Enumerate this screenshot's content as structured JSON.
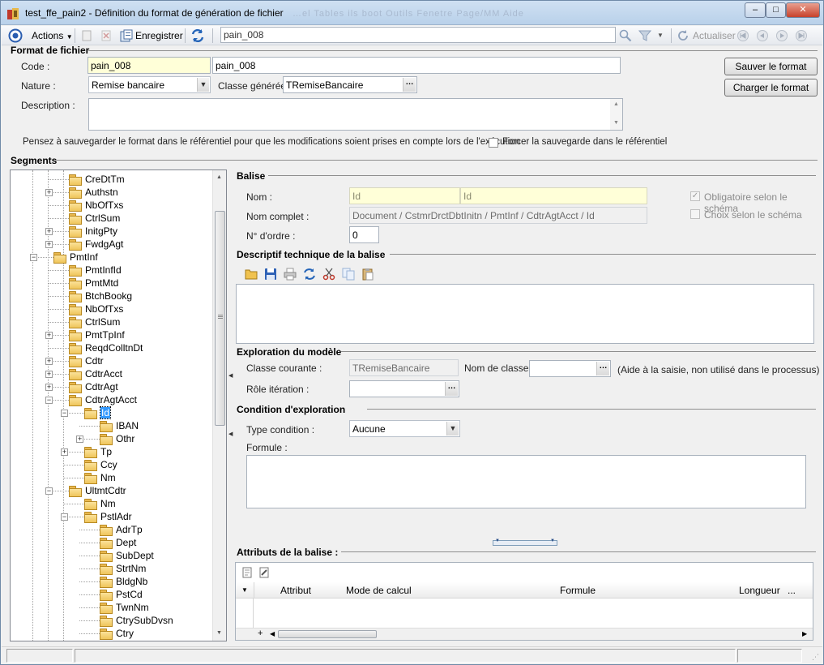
{
  "window": {
    "app": "test_ffe_pain2",
    "title": "test_ffe_pain2 -  Définition du format de génération de fichier",
    "ghost_menu": "…el  Tables  ils  boot  Outils  Fenetre  Page/MM  Aide",
    "minimize": "–",
    "maximize": "□",
    "close": "✕"
  },
  "toolbar": {
    "actions": "Actions",
    "save": "Enregistrer",
    "search_value": "pain_008",
    "refresh": "Actualiser"
  },
  "format": {
    "section": "Format de fichier",
    "code_label": "Code :",
    "code_value": "pain_008",
    "code_desc": "pain_008",
    "nature_label": "Nature :",
    "nature_value": "Remise bancaire",
    "classe_label": "Classe générée :",
    "classe_value": "TRemiseBancaire",
    "description_label": "Description :",
    "save_button": "Sauver le format",
    "load_button": "Charger le format",
    "note": "Pensez à sauvegarder le format dans le référentiel pour que les modifications soient prises en compte lors de l'exécution",
    "force_label": "Forcer la sauvegarde dans le référentiel"
  },
  "segments": {
    "section": "Segments",
    "tree": [
      {
        "label": "CreDtTm",
        "level": 3,
        "expander": ""
      },
      {
        "label": "Authstn",
        "level": 3,
        "expander": "+"
      },
      {
        "label": "NbOfTxs",
        "level": 3,
        "expander": ""
      },
      {
        "label": "CtrlSum",
        "level": 3,
        "expander": ""
      },
      {
        "label": "InitgPty",
        "level": 3,
        "expander": "+"
      },
      {
        "label": "FwdgAgt",
        "level": 3,
        "expander": "+"
      },
      {
        "label": "PmtInf",
        "level": 2,
        "expander": "−"
      },
      {
        "label": "PmtInfId",
        "level": 3,
        "expander": ""
      },
      {
        "label": "PmtMtd",
        "level": 3,
        "expander": ""
      },
      {
        "label": "BtchBookg",
        "level": 3,
        "expander": ""
      },
      {
        "label": "NbOfTxs",
        "level": 3,
        "expander": ""
      },
      {
        "label": "CtrlSum",
        "level": 3,
        "expander": ""
      },
      {
        "label": "PmtTpInf",
        "level": 3,
        "expander": "+"
      },
      {
        "label": "ReqdColltnDt",
        "level": 3,
        "expander": ""
      },
      {
        "label": "Cdtr",
        "level": 3,
        "expander": "+"
      },
      {
        "label": "CdtrAcct",
        "level": 3,
        "expander": "+"
      },
      {
        "label": "CdtrAgt",
        "level": 3,
        "expander": "+"
      },
      {
        "label": "CdtrAgtAcct",
        "level": 3,
        "expander": "−"
      },
      {
        "label": "Id",
        "level": 4,
        "expander": "−",
        "selected": true
      },
      {
        "label": "IBAN",
        "level": 5,
        "expander": ""
      },
      {
        "label": "Othr",
        "level": 5,
        "expander": "+"
      },
      {
        "label": "Tp",
        "level": 4,
        "expander": "+"
      },
      {
        "label": "Ccy",
        "level": 4,
        "expander": ""
      },
      {
        "label": "Nm",
        "level": 4,
        "expander": ""
      },
      {
        "label": "UltmtCdtr",
        "level": 3,
        "expander": "−"
      },
      {
        "label": "Nm",
        "level": 4,
        "expander": ""
      },
      {
        "label": "PstlAdr",
        "level": 4,
        "expander": "−"
      },
      {
        "label": "AdrTp",
        "level": 5,
        "expander": ""
      },
      {
        "label": "Dept",
        "level": 5,
        "expander": ""
      },
      {
        "label": "SubDept",
        "level": 5,
        "expander": ""
      },
      {
        "label": "StrtNm",
        "level": 5,
        "expander": ""
      },
      {
        "label": "BldgNb",
        "level": 5,
        "expander": ""
      },
      {
        "label": "PstCd",
        "level": 5,
        "expander": ""
      },
      {
        "label": "TwnNm",
        "level": 5,
        "expander": ""
      },
      {
        "label": "CtrySubDvsn",
        "level": 5,
        "expander": ""
      },
      {
        "label": "Ctry",
        "level": 5,
        "expander": ""
      }
    ]
  },
  "balise": {
    "section": "Balise",
    "nom_label": "Nom  :",
    "nom_value": "Id",
    "nom_value2": "Id",
    "nom_complet_label": "Nom complet :",
    "nom_complet_value": "Document / CstmrDrctDbtInitn / PmtInf / CdtrAgtAcct / Id",
    "ordre_label": "N° d'ordre :",
    "ordre_value": "0",
    "obligatoire_label": "Obligatoire selon le schéma",
    "choix_label": "Choix selon le schéma"
  },
  "descriptif": {
    "section": "Descriptif technique de la balise"
  },
  "exploration": {
    "section": "Exploration du modèle",
    "classe_courante_label": "Classe courante :",
    "classe_courante_value": "TRemiseBancaire",
    "nom_classe_label": "Nom de classe :",
    "aide": "(Aide à la saisie, non utilisé dans le processus)",
    "role_label": "Rôle itération :"
  },
  "condition": {
    "section": "Condition d'exploration",
    "type_label": "Type condition :",
    "type_value": "Aucune",
    "formule_label": "Formule :"
  },
  "attributs": {
    "section": "Attributs de la balise :",
    "columns": [
      "Attribut",
      "Mode de calcul",
      "Formule",
      "Longueur",
      "..."
    ]
  },
  "colors": {
    "required_field": "#ffffd8",
    "title_bar": "#b9d1ea",
    "selection": "#3399ff"
  }
}
